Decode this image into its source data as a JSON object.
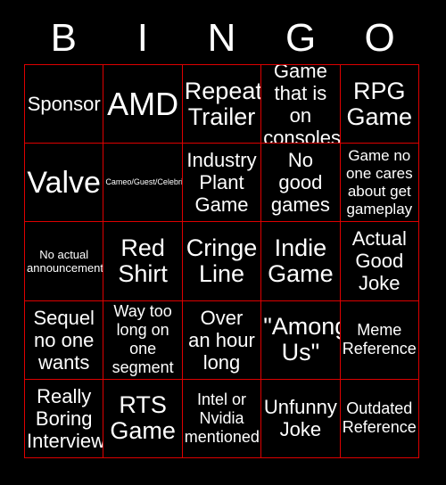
{
  "card": {
    "background_color": "#000000",
    "grid_line_color": "#dd0000",
    "text_color": "#ffffff"
  },
  "header": {
    "letters": [
      {
        "label": "B"
      },
      {
        "label": "I"
      },
      {
        "label": "N"
      },
      {
        "label": "G"
      },
      {
        "label": "O"
      }
    ]
  },
  "grid": {
    "columns": 5,
    "rows": 5,
    "cells": [
      {
        "text": "Sponsor",
        "size": "sz-md",
        "marked": false
      },
      {
        "text": "AMD",
        "size": "sz-xxl",
        "marked": false
      },
      {
        "text": "Repeat\nTrailer",
        "size": "sz-lg",
        "marked": false
      },
      {
        "text": "Game\nthat is on\nconsoles",
        "size": "sz-md",
        "marked": false
      },
      {
        "text": "RPG\nGame",
        "size": "sz-lg",
        "marked": false
      },
      {
        "text": "Valve",
        "size": "sz-xl",
        "marked": false
      },
      {
        "text": "Cameo/Guest/Celebrity",
        "size": "sz-tiny",
        "marked": false
      },
      {
        "text": "Industry\nPlant\nGame",
        "size": "sz-md",
        "marked": false
      },
      {
        "text": "No\ngood\ngames",
        "size": "sz-md",
        "marked": false
      },
      {
        "text": "Game no\none cares\nabout get\ngameplay",
        "size": "sz-xs",
        "marked": false
      },
      {
        "text": "No actual\nannouncements",
        "size": "sz-xxs",
        "marked": false
      },
      {
        "text": "Red\nShirt",
        "size": "sz-lg",
        "marked": false
      },
      {
        "text": "Cringe\nLine",
        "size": "sz-lg",
        "marked": false
      },
      {
        "text": "Indie\nGame",
        "size": "sz-lg",
        "marked": false
      },
      {
        "text": "Actual\nGood\nJoke",
        "size": "sz-md",
        "marked": false
      },
      {
        "text": "Sequel\nno one\nwants",
        "size": "sz-md",
        "marked": false
      },
      {
        "text": "Way too\nlong on\none\nsegment",
        "size": "sz-sm",
        "marked": false
      },
      {
        "text": "Over\nan hour\nlong",
        "size": "sz-md",
        "marked": false
      },
      {
        "text": "\"Among\nUs\"",
        "size": "sz-lg",
        "marked": false
      },
      {
        "text": "Meme\nReference",
        "size": "sz-sm",
        "marked": false
      },
      {
        "text": "Really\nBoring\nInterview",
        "size": "sz-md",
        "marked": false
      },
      {
        "text": "RTS\nGame",
        "size": "sz-lg",
        "marked": false
      },
      {
        "text": "Intel or\nNvidia\nmentioned",
        "size": "sz-sm",
        "marked": false
      },
      {
        "text": "Unfunny\nJoke",
        "size": "sz-md",
        "marked": false
      },
      {
        "text": "Outdated\nReference",
        "size": "sz-sm",
        "marked": false
      }
    ]
  }
}
